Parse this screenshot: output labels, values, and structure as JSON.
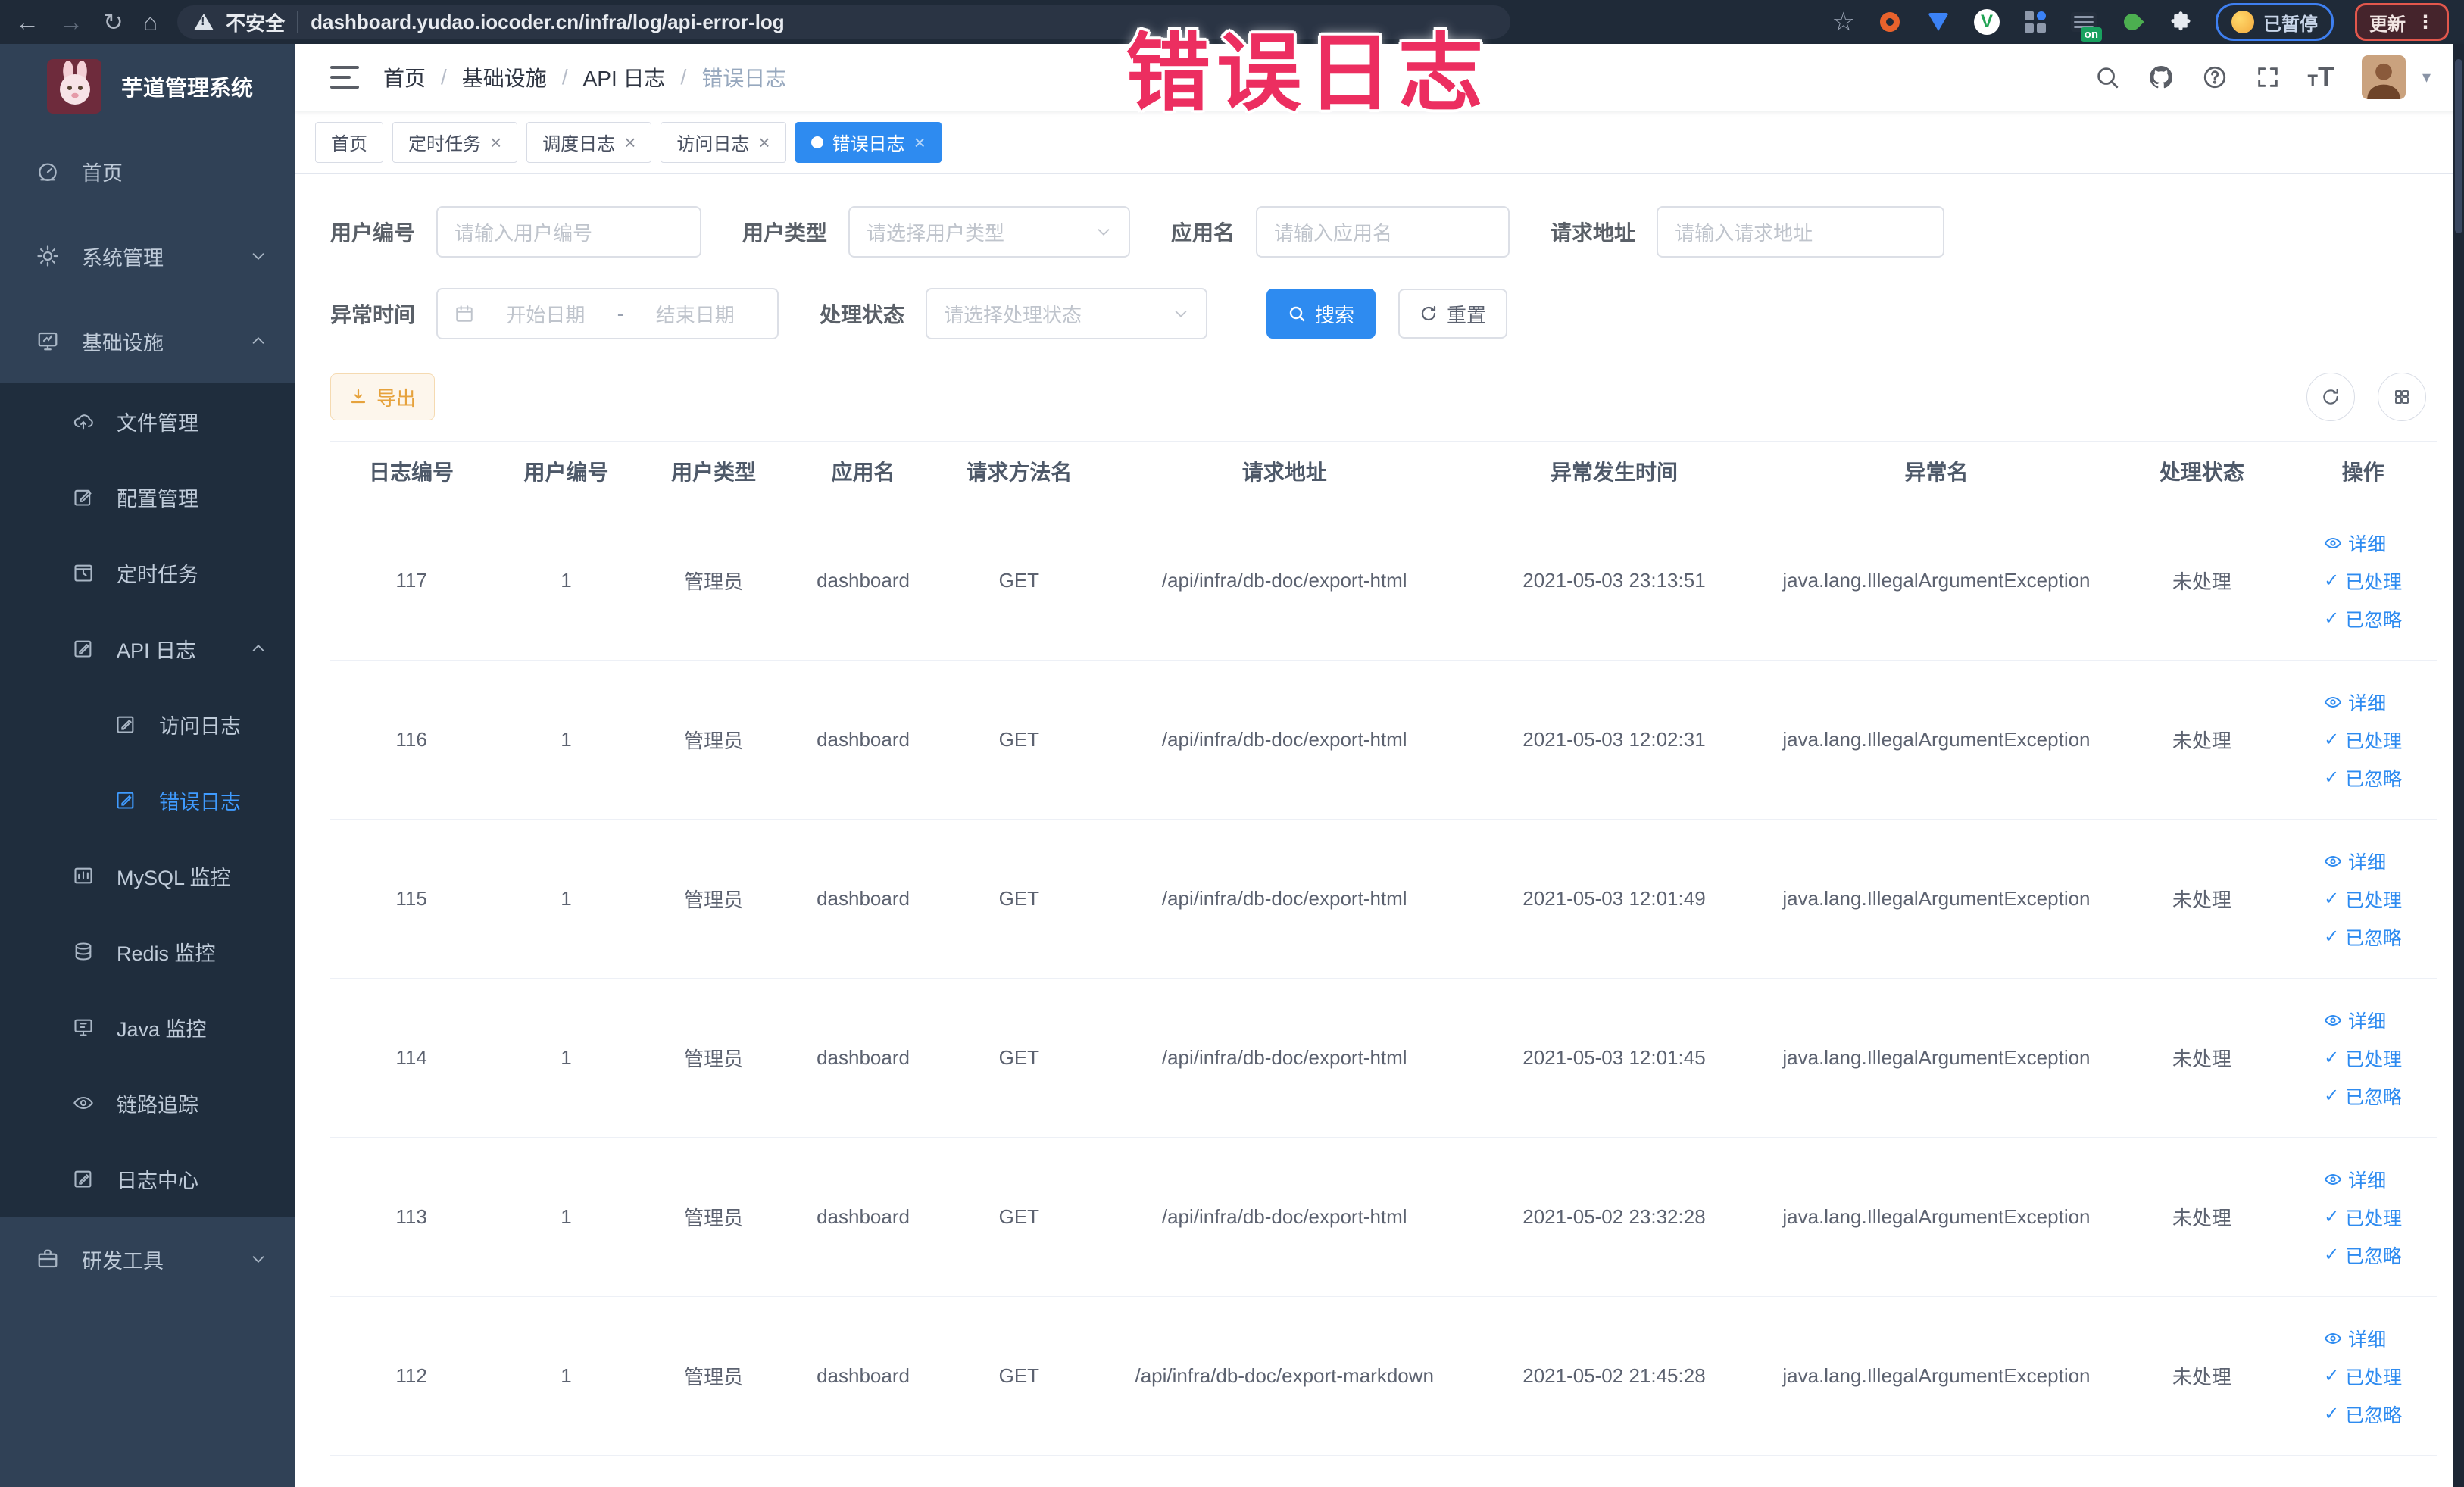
{
  "colors": {
    "accent": "#2e8bf0",
    "warning_text": "#e6a23c",
    "warning_bg": "#fdf6ec",
    "overlay_red": "#ec2e60",
    "sidebar_bg": "#304156",
    "submenu_bg": "#1f2d3d",
    "browser_bar": "#1f2a38"
  },
  "browser": {
    "security_label": "不安全",
    "url": "dashboard.yudao.iocoder.cn/infra/log/api-error-log",
    "paused_label": "已暂停",
    "update_label": "更新",
    "on_badge": "on"
  },
  "overlay_text": "错误日志",
  "sidebar": {
    "title": "芋道管理系统",
    "home": "首页",
    "system": "系统管理",
    "infra": "基础设施",
    "dev": "研发工具",
    "file": "文件管理",
    "config": "配置管理",
    "job": "定时任务",
    "api_log": "API 日志",
    "access_log": "访问日志",
    "error_log": "错误日志",
    "mysql": "MySQL 监控",
    "redis": "Redis 监控",
    "java": "Java 监控",
    "trace": "链路追踪",
    "log_center": "日志中心"
  },
  "breadcrumb": [
    "首页",
    "基础设施",
    "API 日志",
    "错误日志"
  ],
  "tags": [
    {
      "label": "首页"
    },
    {
      "label": "定时任务"
    },
    {
      "label": "调度日志"
    },
    {
      "label": "访问日志"
    },
    {
      "label": "错误日志"
    }
  ],
  "filters": {
    "user_id_label": "用户编号",
    "user_id_placeholder": "请输入用户编号",
    "user_type_label": "用户类型",
    "user_type_placeholder": "请选择用户类型",
    "app_name_label": "应用名",
    "app_name_placeholder": "请输入应用名",
    "request_url_label": "请求地址",
    "request_url_placeholder": "请输入请求地址",
    "time_label": "异常时间",
    "time_start_placeholder": "开始日期",
    "time_separator": "-",
    "time_end_placeholder": "结束日期",
    "status_label": "处理状态",
    "status_placeholder": "请选择处理状态",
    "search_label": "搜索",
    "reset_label": "重置"
  },
  "toolbar": {
    "export_label": "导出"
  },
  "table": {
    "columns": [
      "日志编号",
      "用户编号",
      "用户类型",
      "应用名",
      "请求方法名",
      "请求地址",
      "异常发生时间",
      "异常名",
      "处理状态",
      "操作"
    ],
    "actions": {
      "detail": "详细",
      "processed": "已处理",
      "ignored": "已忽略"
    },
    "rows": [
      {
        "cells": [
          "117",
          "1",
          "管理员",
          "dashboard",
          "GET",
          "/api/infra/db-doc/export-html",
          "2021-05-03 23:13:51",
          "java.lang.IllegalArgumentException",
          "未处理"
        ]
      },
      {
        "cells": [
          "116",
          "1",
          "管理员",
          "dashboard",
          "GET",
          "/api/infra/db-doc/export-html",
          "2021-05-03 12:02:31",
          "java.lang.IllegalArgumentException",
          "未处理"
        ]
      },
      {
        "cells": [
          "115",
          "1",
          "管理员",
          "dashboard",
          "GET",
          "/api/infra/db-doc/export-html",
          "2021-05-03 12:01:49",
          "java.lang.IllegalArgumentException",
          "未处理"
        ]
      },
      {
        "cells": [
          "114",
          "1",
          "管理员",
          "dashboard",
          "GET",
          "/api/infra/db-doc/export-html",
          "2021-05-03 12:01:45",
          "java.lang.IllegalArgumentException",
          "未处理"
        ]
      },
      {
        "cells": [
          "113",
          "1",
          "管理员",
          "dashboard",
          "GET",
          "/api/infra/db-doc/export-html",
          "2021-05-02 23:32:28",
          "java.lang.IllegalArgumentException",
          "未处理"
        ]
      },
      {
        "cells": [
          "112",
          "1",
          "管理员",
          "dashboard",
          "GET",
          "/api/infra/db-doc/export-markdown",
          "2021-05-02 21:45:28",
          "java.lang.IllegalArgumentException",
          "未处理"
        ]
      }
    ]
  }
}
